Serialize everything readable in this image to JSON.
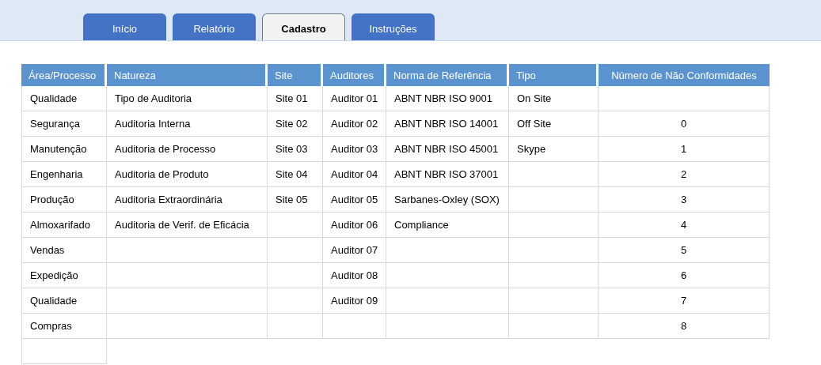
{
  "tabs": [
    {
      "label": "Início",
      "selected": false
    },
    {
      "label": "Relatório",
      "selected": false
    },
    {
      "label": "Cadastro",
      "selected": true
    },
    {
      "label": "Instruções",
      "selected": false
    }
  ],
  "table": {
    "columns": [
      {
        "label": "Área/Processo",
        "kind": "text"
      },
      {
        "label": "Natureza",
        "kind": "text"
      },
      {
        "label": "Site",
        "kind": "text"
      },
      {
        "label": "Auditores",
        "kind": "text"
      },
      {
        "label": "Norma de Referência",
        "kind": "text"
      },
      {
        "label": "Tipo",
        "kind": "text"
      },
      {
        "label": "Número de Não Conformidades",
        "kind": "number"
      }
    ],
    "rows": [
      [
        "Qualidade",
        "Tipo de Auditoria",
        "Site 01",
        "Auditor 01",
        "ABNT NBR ISO 9001",
        "On Site",
        null
      ],
      [
        "Segurança",
        "Auditoria Interna",
        "Site 02",
        "Auditor 02",
        "ABNT NBR ISO 14001",
        "Off Site",
        "0"
      ],
      [
        "Manutenção",
        "Auditoria de Processo",
        "Site 03",
        "Auditor 03",
        "ABNT NBR ISO 45001",
        "Skype",
        "1"
      ],
      [
        "Engenharia",
        "Auditoria de Produto",
        "Site 04",
        "Auditor 04",
        "ABNT NBR ISO 37001",
        null,
        "2"
      ],
      [
        "Produção",
        "Auditoria Extraordinária",
        "Site 05",
        "Auditor 05",
        "Sarbanes-Oxley (SOX)",
        null,
        "3"
      ],
      [
        "Almoxarifado",
        "Auditoria de Verif. de Eficácia",
        null,
        "Auditor 06",
        "Compliance",
        null,
        "4"
      ],
      [
        "Vendas",
        null,
        null,
        "Auditor 07",
        null,
        null,
        "5"
      ],
      [
        "Expedição",
        null,
        null,
        "Auditor 08",
        null,
        null,
        "6"
      ],
      [
        "Qualidade",
        null,
        null,
        "Auditor 09",
        null,
        null,
        "7"
      ],
      [
        "Compras",
        null,
        null,
        null,
        null,
        null,
        "8"
      ]
    ]
  }
}
